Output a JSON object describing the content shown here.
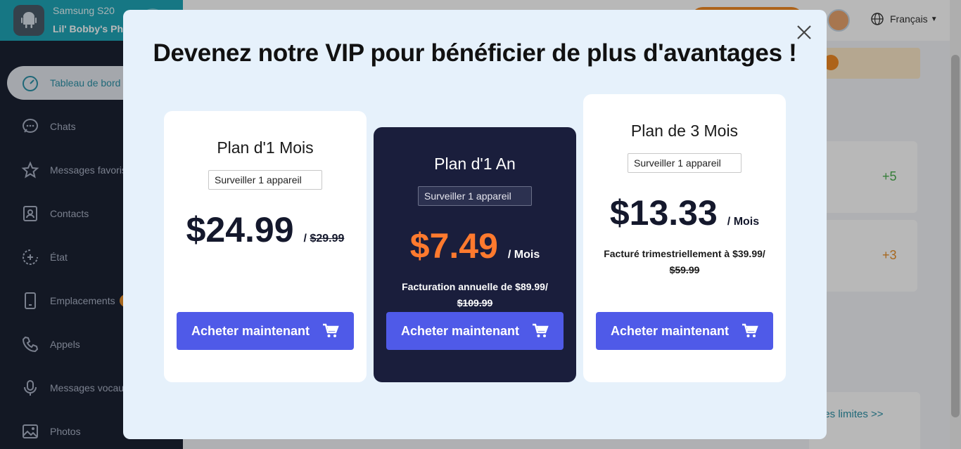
{
  "app": {
    "device": {
      "name": "Samsung S20",
      "owner": "Lil' Bobby's Pho..."
    },
    "sidebar": {
      "items": [
        {
          "label": "Tableau de bord",
          "icon": "dashboard-icon",
          "active": true
        },
        {
          "label": "Chats",
          "icon": "chat-icon"
        },
        {
          "label": "Messages favoris",
          "icon": "star-icon"
        },
        {
          "label": "Contacts",
          "icon": "contacts-icon"
        },
        {
          "label": "État",
          "icon": "status-icon"
        },
        {
          "label": "Emplacements",
          "icon": "location-device-icon",
          "badge": true
        },
        {
          "label": "Appels",
          "icon": "phone-icon"
        },
        {
          "label": "Messages vocaux",
          "icon": "microphone-icon"
        },
        {
          "label": "Photos",
          "icon": "photo-icon"
        }
      ]
    },
    "topbar": {
      "language": "Français"
    },
    "stats": [
      {
        "value": "+5",
        "color": "#4caf50"
      },
      {
        "value": "+3",
        "color": "#e8912c"
      }
    ],
    "limits_link": "les limites >>"
  },
  "modal": {
    "title": "Devenez notre VIP pour bénéficier de plus d'avantages !",
    "plans": [
      {
        "name": "Plan d'1 Mois",
        "device_option": "Surveiller 1 appareil",
        "price": "$24.99",
        "suffix_prefix": "/ ",
        "old_price": "$29.99",
        "button": "Acheter maintenant"
      },
      {
        "name": "Plan d'1 An",
        "device_option": "Surveiller 1 appareil",
        "price": "$7.49",
        "suffix": "/ Mois",
        "billing_prefix": "Facturation annuelle de $89.99/ ",
        "billing_old": "$109.99",
        "button": "Acheter maintenant",
        "accent": "#ff7a2e"
      },
      {
        "name": "Plan de 3 Mois",
        "device_option": "Surveiller 1 appareil",
        "price": "$13.33",
        "suffix": "/ Mois",
        "billing_prefix": "Facturé trimestriellement à $39.99/",
        "billing_old": "$59.99",
        "button": "Acheter maintenant"
      }
    ]
  },
  "colors": {
    "button": "#4f5ae8",
    "featured_card": "#1a1e3c",
    "modal_bg": "#e6f1fb"
  }
}
